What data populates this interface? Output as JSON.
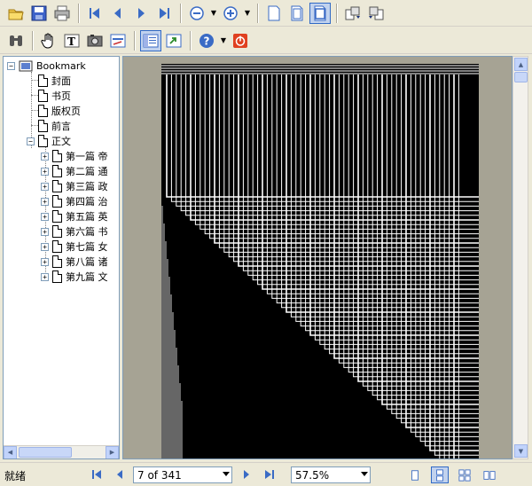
{
  "toolbar_top": {
    "buttons": [
      {
        "name": "open-icon"
      },
      {
        "name": "save-icon"
      },
      {
        "name": "print-icon"
      },
      {
        "name": "first-page-icon"
      },
      {
        "name": "previous-page-icon"
      },
      {
        "name": "next-page-icon"
      },
      {
        "name": "last-page-icon"
      },
      {
        "name": "zoom-out-icon"
      },
      {
        "name": "zoom-in-icon"
      },
      {
        "name": "actual-size-icon"
      },
      {
        "name": "fit-page-icon"
      },
      {
        "name": "fit-width-icon"
      },
      {
        "name": "rotate-clockwise-icon"
      },
      {
        "name": "rotate-counterclockwise-icon"
      }
    ]
  },
  "toolbar_bottom": {
    "buttons": [
      {
        "name": "find-icon"
      },
      {
        "name": "hand-tool-icon"
      },
      {
        "name": "text-select-icon"
      },
      {
        "name": "snapshot-icon"
      },
      {
        "name": "form-icon"
      },
      {
        "name": "bookmark-panel-icon"
      },
      {
        "name": "export-icon"
      },
      {
        "name": "help-icon"
      },
      {
        "name": "exit-icon"
      }
    ]
  },
  "bookmarks": {
    "root": "Bookmark",
    "items": [
      {
        "label": "封面"
      },
      {
        "label": "书页"
      },
      {
        "label": "版权页"
      },
      {
        "label": "前言"
      },
      {
        "label": "正文"
      }
    ],
    "children": [
      {
        "label": "第一篇  帝"
      },
      {
        "label": "第二篇  通"
      },
      {
        "label": "第三篇  政"
      },
      {
        "label": "第四篇  治"
      },
      {
        "label": "第五篇  英"
      },
      {
        "label": "第六篇  书"
      },
      {
        "label": "第七篇  女"
      },
      {
        "label": "第八篇  诸"
      },
      {
        "label": "第九篇  文"
      }
    ]
  },
  "status": {
    "text": "就绪",
    "page_indicator": "7 of 341",
    "zoom": "57.5%"
  }
}
